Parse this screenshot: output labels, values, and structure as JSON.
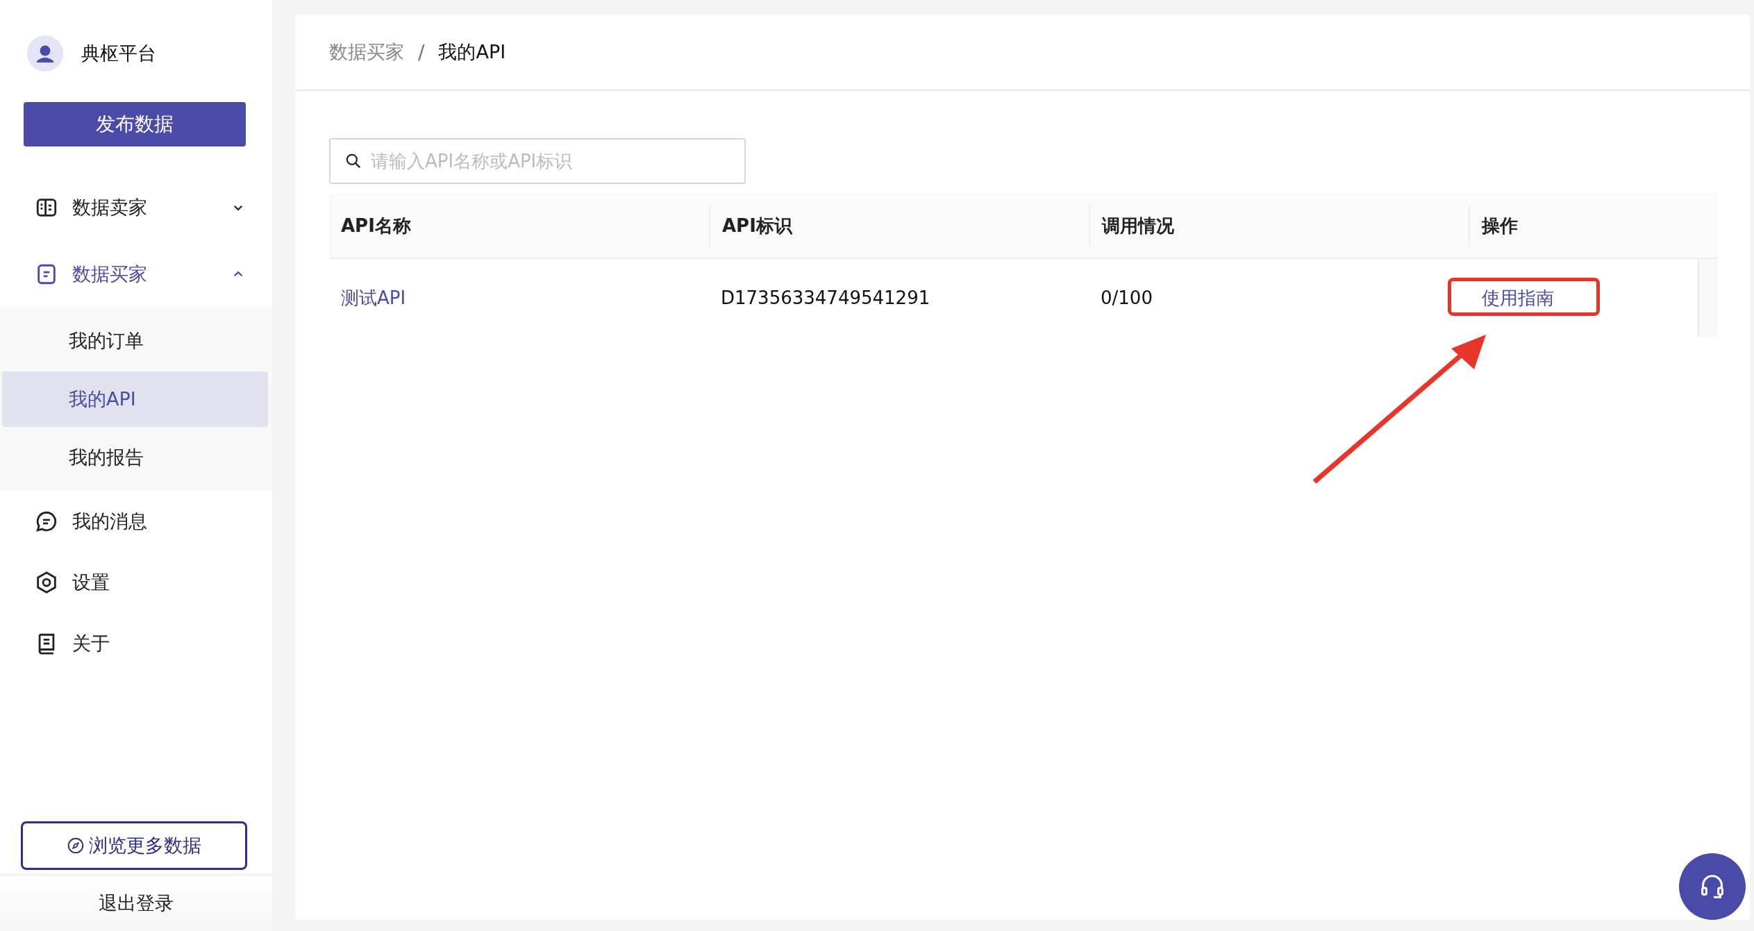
{
  "brand": {
    "name": "典枢平台"
  },
  "publish_button": "发布数据",
  "menu": [
    {
      "label": "数据卖家",
      "kind": "group",
      "expanded": false,
      "selected": false
    },
    {
      "label": "数据买家",
      "kind": "group",
      "expanded": true,
      "selected": true,
      "children": [
        {
          "label": "我的订单",
          "selected": false
        },
        {
          "label": "我的API",
          "selected": true
        },
        {
          "label": "我的报告",
          "selected": false
        }
      ]
    },
    {
      "label": "我的消息",
      "kind": "item",
      "selected": false
    },
    {
      "label": "设置",
      "kind": "item",
      "selected": false
    },
    {
      "label": "关于",
      "kind": "item",
      "selected": false
    }
  ],
  "browse_button": "浏览更多数据",
  "logout": "退出登录",
  "breadcrumb": [
    {
      "label": "数据买家",
      "kind": "link",
      "current": false
    },
    {
      "label": "/",
      "kind": "separator"
    },
    {
      "label": "我的API",
      "kind": "link",
      "current": true
    }
  ],
  "search": {
    "placeholder": "请输入API名称或API标识"
  },
  "table": {
    "columns": [
      "API名称",
      "API标识",
      "调用情况",
      "操作"
    ],
    "rows": [
      {
        "name": "测试API",
        "id": "D17356334749541291",
        "usage": "0/100",
        "action": "使用指南"
      }
    ]
  }
}
